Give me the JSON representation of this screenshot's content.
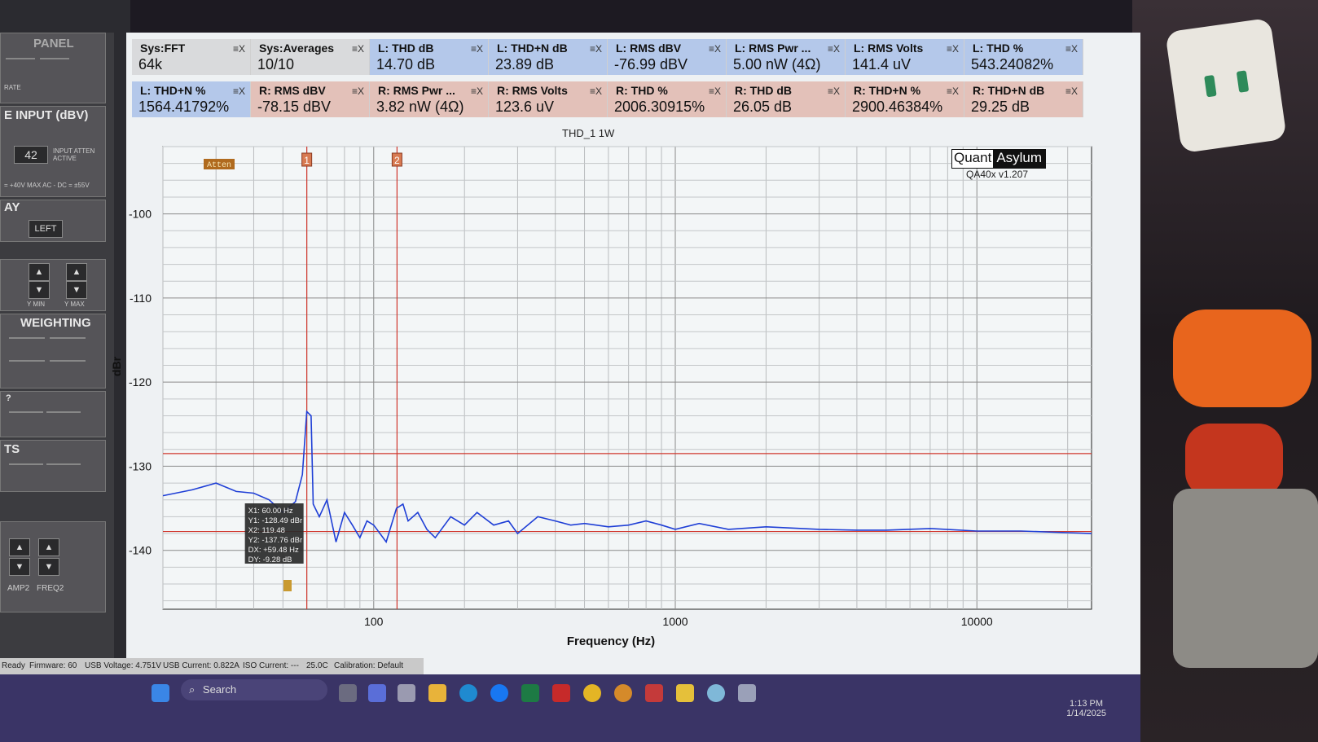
{
  "stats_row1": [
    {
      "label": "Sys:FFT",
      "value": "64k",
      "color": "g"
    },
    {
      "label": "Sys:Averages",
      "value": "10/10",
      "color": "g"
    },
    {
      "label": "L: THD dB",
      "value": "14.70 dB",
      "color": "b"
    },
    {
      "label": "L: THD+N dB",
      "value": "23.89 dB",
      "color": "b"
    },
    {
      "label": "L: RMS dBV",
      "value": "-76.99 dBV",
      "color": "b"
    },
    {
      "label": "L: RMS Pwr ...",
      "value": "5.00 nW (4Ω)",
      "color": "b"
    },
    {
      "label": "L: RMS Volts",
      "value": "141.4 uV",
      "color": "b"
    },
    {
      "label": "L: THD %",
      "value": "543.24082%",
      "color": "b"
    }
  ],
  "stats_row2": [
    {
      "label": "L: THD+N %",
      "value": "1564.41792%",
      "color": "b"
    },
    {
      "label": "R: RMS dBV",
      "value": "-78.15 dBV",
      "color": "r"
    },
    {
      "label": "R: RMS Pwr ...",
      "value": "3.82 nW (4Ω)",
      "color": "r"
    },
    {
      "label": "R: RMS Volts",
      "value": "123.6 uV",
      "color": "r"
    },
    {
      "label": "R: THD %",
      "value": "2006.30915%",
      "color": "r"
    },
    {
      "label": "R: THD dB",
      "value": "26.05 dB",
      "color": "r"
    },
    {
      "label": "R: THD+N %",
      "value": "2900.46384%",
      "color": "r"
    },
    {
      "label": "R: THD+N dB",
      "value": "29.25 dB",
      "color": "r"
    }
  ],
  "stat_ctrl_icons": "≡X",
  "chart_title": "THD_1 1W",
  "logo": {
    "left": "Quant",
    "right": "Asylum"
  },
  "version": "QA40x v1.207",
  "atten_label": "Atten",
  "cursor_1": "1",
  "cursor_2": "2",
  "readout": [
    "X1: 60.00 Hz",
    "Y1: -128.49 dBr",
    "X2: 119.48",
    "Y2: -137.76 dBr",
    "DX: +59.48 Hz",
    "DY: -9.28 dB"
  ],
  "chart_data": {
    "type": "line",
    "xlabel": "Frequency (Hz)",
    "ylabel": "dBr",
    "x_scale": "log",
    "xlim": [
      20,
      24000
    ],
    "ylim": [
      -147,
      -92
    ],
    "x_ticks": [
      "100",
      "1000",
      "10000"
    ],
    "y_ticks": [
      "-100",
      "-110",
      "-120",
      "-130",
      "-140"
    ],
    "grid": true,
    "cursor_x": [
      60,
      119.48
    ],
    "cursor_y": [
      -128.49,
      -137.76
    ],
    "series": [
      {
        "color": "#1f3fd6",
        "x": [
          20,
          25,
          30,
          35,
          40,
          45,
          50,
          55,
          58,
          60,
          62,
          63,
          66,
          70,
          75,
          80,
          85,
          90,
          95,
          100,
          110,
          119,
          125,
          130,
          140,
          150,
          160,
          180,
          200,
          220,
          250,
          280,
          300,
          350,
          400,
          450,
          500,
          600,
          700,
          800,
          900,
          1000,
          1200,
          1500,
          2000,
          3000,
          4000,
          5000,
          7000,
          10000,
          14000,
          20000,
          24000
        ],
        "y": [
          -133.5,
          -132.8,
          -132,
          -133,
          -133.2,
          -134,
          -135.5,
          -134.2,
          -131,
          -123.5,
          -124,
          -134.5,
          -136,
          -134,
          -139,
          -135.5,
          -137,
          -138.5,
          -136.5,
          -137,
          -139,
          -135,
          -134.5,
          -136.5,
          -135.5,
          -137.5,
          -138.5,
          -136,
          -137,
          -135.5,
          -137,
          -136.5,
          -138,
          -136,
          -136.5,
          -137,
          -136.8,
          -137.2,
          -137,
          -136.5,
          -137,
          -137.5,
          -136.8,
          -137.5,
          -137.2,
          -137.5,
          -137.6,
          -137.6,
          -137.4,
          -137.7,
          -137.7,
          -137.9,
          -138
        ]
      }
    ]
  },
  "statusbar": [
    "Ready",
    "Firmware: 60",
    "USB Voltage: 4.751V",
    "USB Current: 0.822A",
    "ISO Current: ---",
    "25.0C",
    "Calibration: Default"
  ],
  "left_panel": {
    "title_top": "PANEL",
    "rate": "RATE",
    "input_title": "E INPUT (dBV)",
    "input_value": "42",
    "input_note": "INPUT ATTEN ACTIVE",
    "input_caption": "= +40V  MAX AC  - DC = ±55V",
    "display_title": "AY",
    "left_btn": "LEFT",
    "ymin": "Y MIN",
    "ymax": "Y MAX",
    "weighting": "WEIGHTING",
    "help": "?",
    "ts": "TS",
    "amp2": "AMP2",
    "freq2": "FREQ2"
  },
  "taskbar": {
    "search": "Search",
    "time": "1:13 PM",
    "date": "1/14/2025"
  }
}
